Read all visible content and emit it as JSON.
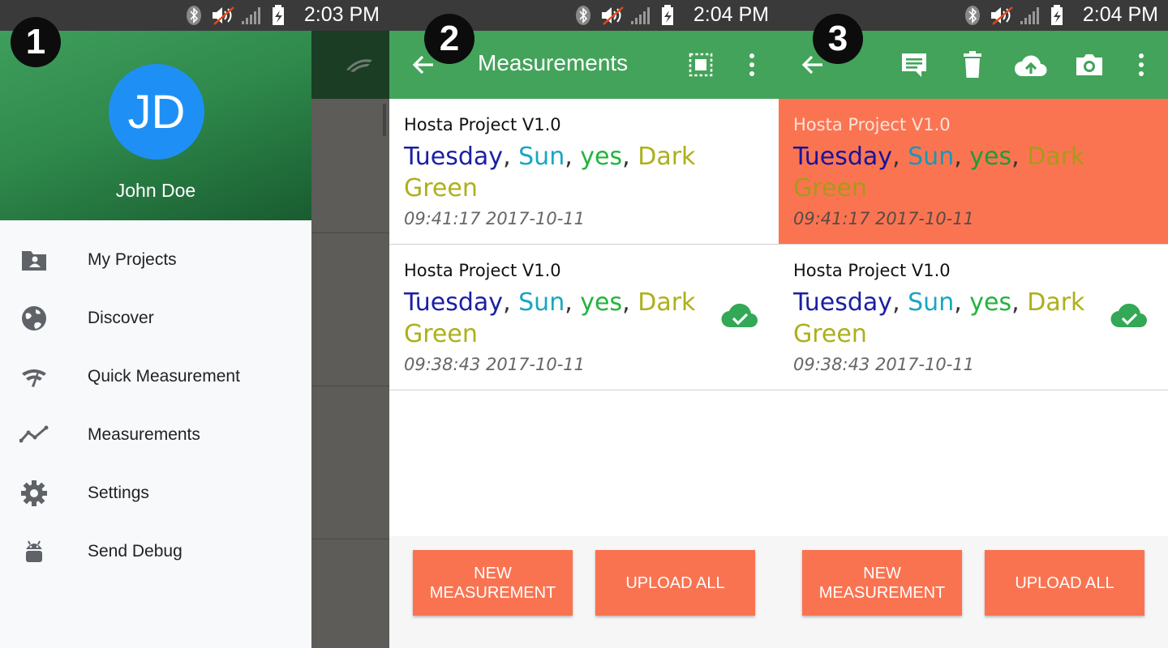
{
  "status_times": [
    "2:03 PM",
    "2:04 PM",
    "2:04 PM"
  ],
  "step_badges": [
    "1",
    "2",
    "3"
  ],
  "drawer": {
    "avatar_initials": "JD",
    "user_name": "John Doe",
    "menu": [
      {
        "label": "My Projects",
        "icon": "folder-account-icon"
      },
      {
        "label": "Discover",
        "icon": "globe-icon"
      },
      {
        "label": "Quick Measurement",
        "icon": "quick-measure-icon"
      },
      {
        "label": "Measurements",
        "icon": "trend-line-icon"
      },
      {
        "label": "Settings",
        "icon": "gear-icon"
      },
      {
        "label": "Send Debug",
        "icon": "android-icon"
      }
    ]
  },
  "screen2": {
    "title": "Measurements",
    "items": [
      {
        "project": "Hosta Project V1.0",
        "day": "Tuesday",
        "weather": "Sun",
        "answer": "yes",
        "color": "Dark Green",
        "time": "09:41:17 2017-10-11",
        "uploaded": false
      },
      {
        "project": "Hosta Project V1.0",
        "day": "Tuesday",
        "weather": "Sun",
        "answer": "yes",
        "color": "Dark Green",
        "time": "09:38:43 2017-10-11",
        "uploaded": true
      }
    ],
    "buttons": {
      "new": "NEW MEASUREMENT",
      "upload": "UPLOAD ALL"
    }
  },
  "screen3": {
    "items": [
      {
        "project": "Hosta Project V1.0",
        "day": "Tuesday",
        "weather": "Sun",
        "answer": "yes",
        "color": "Dark Green",
        "time": "09:41:17 2017-10-11",
        "uploaded": false,
        "selected": true
      },
      {
        "project": "Hosta Project V1.0",
        "day": "Tuesday",
        "weather": "Sun",
        "answer": "yes",
        "color": "Dark Green",
        "time": "09:38:43 2017-10-11",
        "uploaded": true
      }
    ],
    "buttons": {
      "new": "NEW MEASUREMENT",
      "upload": "UPLOAD ALL"
    }
  },
  "colors": {
    "appbar": "#43a35a",
    "accent": "#fa7351",
    "selected": "#fb7452",
    "avatar": "#1e90f5"
  }
}
